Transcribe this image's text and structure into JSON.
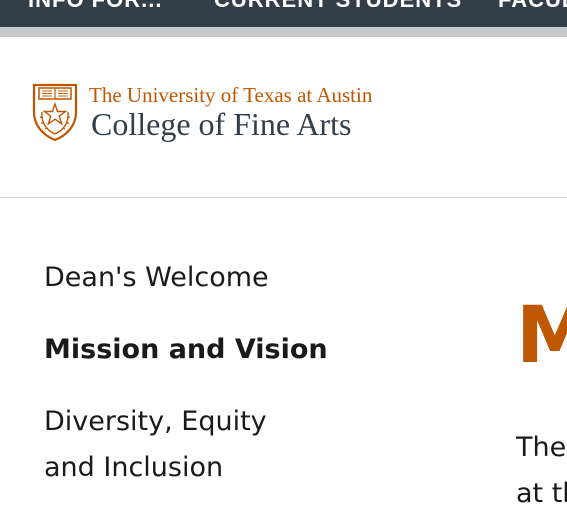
{
  "top_nav": {
    "items": [
      {
        "label": "INFO FOR..."
      },
      {
        "label": "CURRENT STUDENTS"
      },
      {
        "label": "FACULTY"
      }
    ]
  },
  "header": {
    "university_name": "The University of Texas at Austin",
    "college_name": "College of Fine Arts"
  },
  "sidebar": {
    "items": [
      {
        "label": "Dean's Welcome",
        "active": false
      },
      {
        "label": "Mission and Vision",
        "active": true
      },
      {
        "label": "Diversity, Equity and Inclusion",
        "active": false
      }
    ]
  },
  "main": {
    "heading": "Mission and Vision",
    "paragraph": "The College of Fine Arts at the"
  },
  "colors": {
    "nav_background": "#333f48",
    "accent_orange": "#bf5700",
    "divider": "#d6d6d6"
  },
  "icons": {
    "logo": "ut-seal-icon"
  }
}
